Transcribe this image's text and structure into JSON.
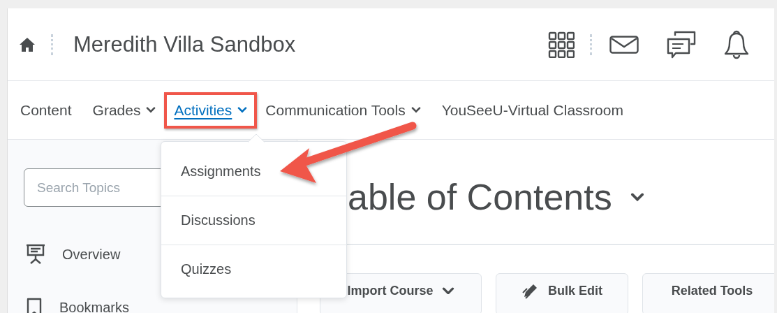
{
  "header": {
    "title": "Meredith Villa Sandbox"
  },
  "nav": [
    {
      "label": "Content",
      "has_menu": false,
      "selected": false
    },
    {
      "label": "Grades",
      "has_menu": true,
      "selected": false
    },
    {
      "label": "Activities",
      "has_menu": true,
      "selected": true
    },
    {
      "label": "Communication Tools",
      "has_menu": true,
      "selected": false
    },
    {
      "label": "YouSeeU-Virtual Classroom",
      "has_menu": false,
      "selected": false
    }
  ],
  "menu": {
    "items": [
      "Assignments",
      "Discussions",
      "Quizzes"
    ]
  },
  "sidebar": {
    "search": {
      "placeholder": "Search Topics"
    },
    "items": [
      {
        "label": "Overview",
        "kind": "overview"
      },
      {
        "label": "Bookmarks",
        "kind": "bookmark"
      }
    ]
  },
  "main": {
    "heading": "able of Contents",
    "buttons": [
      {
        "label": "Import Course",
        "kind": "dropdown"
      },
      {
        "label": "Bulk Edit",
        "kind": "edit"
      },
      {
        "label": "Related Tools",
        "kind": "plain"
      }
    ]
  }
}
